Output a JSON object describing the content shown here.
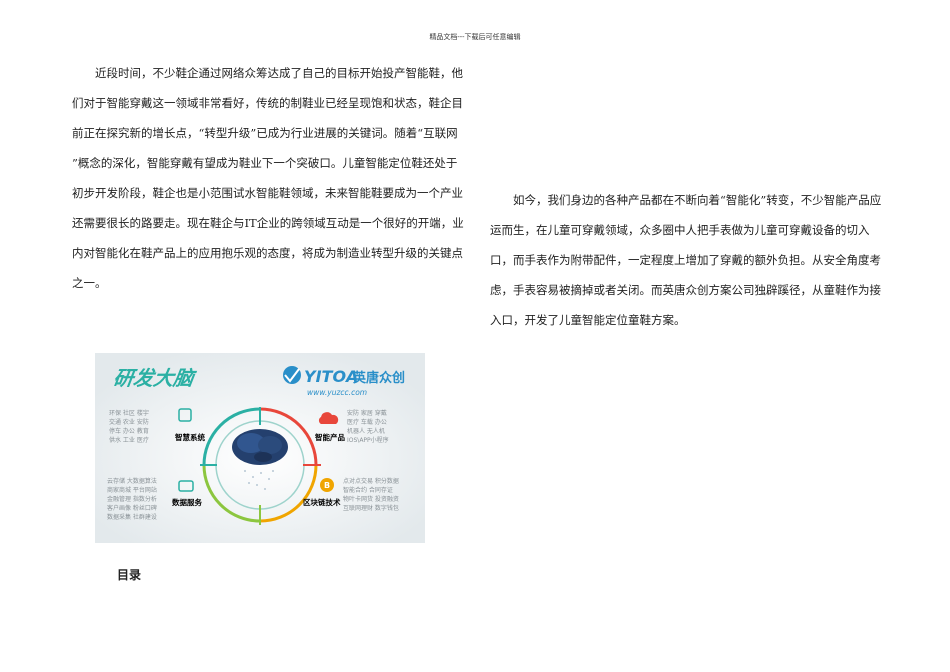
{
  "header": {
    "text": "精品文档---下载后可任意编辑"
  },
  "left_paragraph": "近段时间，不少鞋企通过网络众筹达成了自己的目标开始投产智能鞋，他们对于智能穿戴这一领域非常看好，传统的制鞋业已经呈现饱和状态，鞋企目前正在探究新的增长点，“转型升级”已成为行业进展的关键词。随着“互联网 ”概念的深化，智能穿戴有望成为鞋业下一个突破口。儿童智能定位鞋还处于初步开发阶段，鞋企也是小范围试水智能鞋领域，未来智能鞋要成为一个产业还需要很长的路要走。现在鞋企与IT企业的跨领域互动是一个很好的开端，业内对智能化在鞋产品上的应用抱乐观的态度，将成为制造业转型升级的关键点之一。",
  "right_paragraph": "如今，我们身边的各种产品都在不断向着“智能化”转变，不少智能产品应运而生，在儿童可穿戴领域，众多圈中人把手表做为儿童可穿戴设备的切入口，而手表作为附带配件，一定程度上增加了穿戴的额外负担。从安全角度考虑，手表容易被摘掉或者关闭。而英唐众创方案公司独辟蹊径，从童鞋作为接入口，开发了儿童智能定位童鞋方案。",
  "banner": {
    "title": "研发大脑",
    "logo_text": "YITOA",
    "logo_cn": "英唐众创",
    "url": "www.yuzcc.com",
    "quadrants": [
      {
        "label": "智慧系统",
        "color": "#2bb0a4",
        "tags": [
          "环保 社区 楼宇",
          "交通 农业 安防",
          "停车 办公 教育",
          "供水 工业 医疗"
        ]
      },
      {
        "label": "智能产品",
        "color": "#e8473b",
        "tags": [
          "安防 家居 穿戴",
          "医疗 车载 办公",
          "机器人 无人机",
          "IOS\\APP小程序"
        ]
      },
      {
        "label": "数据服务",
        "color": "#2bb0a4",
        "tags": [
          "云存储 大数据算法",
          "商家商城 平台网站",
          "金融管理 指数分析",
          "客户画像 粉丝口碑",
          "数据采集 社群建设"
        ]
      },
      {
        "label": "区块链技术",
        "color": "#f0a500",
        "tags": [
          "点对点交易 积分数据",
          "智能合约 合同存证",
          "物叶卡网货 投资融资",
          "互联网理财 数字钱包"
        ]
      }
    ]
  },
  "toc_heading": "目录"
}
